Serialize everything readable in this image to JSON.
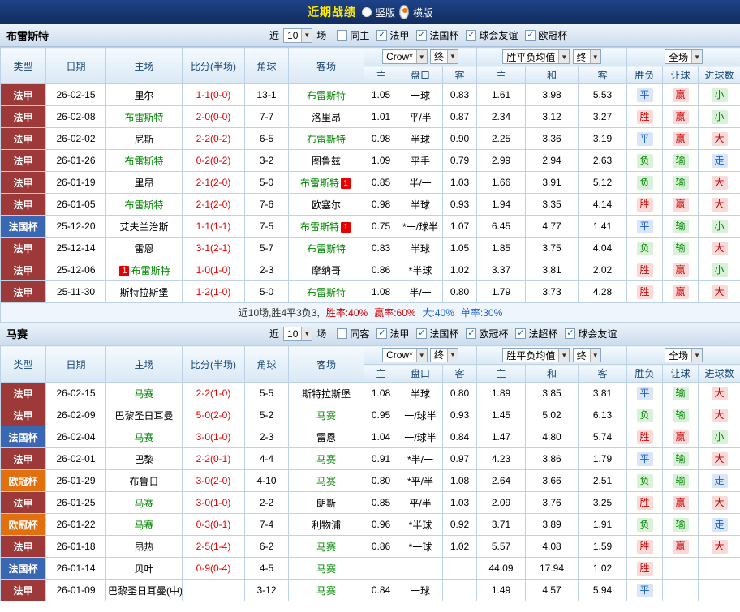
{
  "top_bar": {
    "title": "近期战绩",
    "vertical_label": "竖版",
    "horizontal_label": "横版",
    "selected_mode": "横版"
  },
  "labels": {
    "near": "近",
    "games": "场"
  },
  "table_header": {
    "fixed_cols": [
      "类型",
      "日期",
      "主场",
      "比分(半场)",
      "角球",
      "客场"
    ],
    "odds_source": "Crow*",
    "final": "终",
    "avg_source": "胜平负均值",
    "scope": "全场",
    "sub_cols": [
      "主",
      "盘口",
      "客",
      "主",
      "和",
      "客",
      "胜负",
      "让球",
      "进球数"
    ]
  },
  "colors": {
    "league": {
      "法甲": "#9e3939",
      "法国杯": "#3a67b1",
      "欧冠杯": "#e2700f"
    },
    "score": "#e60000",
    "focus_team": "#008800",
    "card_badge_bg": "#e60000",
    "badge": {
      "red": {
        "fg": "#cc0000",
        "bg": "#fad9d9"
      },
      "green": {
        "fg": "#008800",
        "bg": "#d9f0d9"
      },
      "blue": {
        "fg": "#1a5fd0",
        "bg": "#d9e6f8"
      }
    },
    "word_tone": {
      "胜": "red",
      "平": "blue",
      "负": "green",
      "赢": "red",
      "输": "green",
      "走": "blue",
      "大": "red",
      "小": "green"
    },
    "summary_plain": "#333333"
  },
  "sections": [
    {
      "team": "布雷斯特",
      "count": "10",
      "filters": [
        {
          "label": "同主",
          "checked": false
        },
        {
          "label": "法甲",
          "checked": true
        },
        {
          "label": "法国杯",
          "checked": true
        },
        {
          "label": "球会友谊",
          "checked": true
        },
        {
          "label": "欧冠杯",
          "checked": true
        }
      ],
      "rows": [
        {
          "type": "法甲",
          "date": "26-02-15",
          "home": "里尔",
          "home_focus": false,
          "home_card": "",
          "score": "1-1(0-0)",
          "corner": "13-1",
          "away": "布雷斯特",
          "away_focus": true,
          "away_card": "",
          "odds": [
            "1.05",
            "一球",
            "0.83"
          ],
          "avg": [
            "1.61",
            "3.98",
            "5.53"
          ],
          "results": [
            "平",
            "赢",
            "小"
          ]
        },
        {
          "type": "法甲",
          "date": "26-02-08",
          "home": "布雷斯特",
          "home_focus": true,
          "home_card": "",
          "score": "2-0(0-0)",
          "corner": "7-7",
          "away": "洛里昂",
          "away_focus": false,
          "away_card": "",
          "odds": [
            "1.01",
            "平/半",
            "0.87"
          ],
          "avg": [
            "2.34",
            "3.12",
            "3.27"
          ],
          "results": [
            "胜",
            "赢",
            "小"
          ]
        },
        {
          "type": "法甲",
          "date": "26-02-02",
          "home": "尼斯",
          "home_focus": false,
          "home_card": "",
          "score": "2-2(0-2)",
          "corner": "6-5",
          "away": "布雷斯特",
          "away_focus": true,
          "away_card": "",
          "odds": [
            "0.98",
            "半球",
            "0.90"
          ],
          "avg": [
            "2.25",
            "3.36",
            "3.19"
          ],
          "results": [
            "平",
            "赢",
            "大"
          ]
        },
        {
          "type": "法甲",
          "date": "26-01-26",
          "home": "布雷斯特",
          "home_focus": true,
          "home_card": "",
          "score": "0-2(0-2)",
          "corner": "3-2",
          "away": "图鲁兹",
          "away_focus": false,
          "away_card": "",
          "odds": [
            "1.09",
            "平手",
            "0.79"
          ],
          "avg": [
            "2.99",
            "2.94",
            "2.63"
          ],
          "results": [
            "负",
            "输",
            "走"
          ]
        },
        {
          "type": "法甲",
          "date": "26-01-19",
          "home": "里昂",
          "home_focus": false,
          "home_card": "",
          "score": "2-1(2-0)",
          "corner": "5-0",
          "away": "布雷斯特",
          "away_focus": true,
          "away_card": "1",
          "odds": [
            "0.85",
            "半/一",
            "1.03"
          ],
          "avg": [
            "1.66",
            "3.91",
            "5.12"
          ],
          "results": [
            "负",
            "输",
            "大"
          ]
        },
        {
          "type": "法甲",
          "date": "26-01-05",
          "home": "布雷斯特",
          "home_focus": true,
          "home_card": "",
          "score": "2-1(2-0)",
          "corner": "7-6",
          "away": "欧塞尔",
          "away_focus": false,
          "away_card": "",
          "odds": [
            "0.98",
            "半球",
            "0.93"
          ],
          "avg": [
            "1.94",
            "3.35",
            "4.14"
          ],
          "results": [
            "胜",
            "赢",
            "大"
          ]
        },
        {
          "type": "法国杯",
          "date": "25-12-20",
          "home": "艾夫兰治斯",
          "home_focus": false,
          "home_card": "",
          "score": "1-1(1-1)",
          "corner": "7-5",
          "away": "布雷斯特",
          "away_focus": true,
          "away_card": "1",
          "odds": [
            "0.75",
            "*一/球半",
            "1.07"
          ],
          "avg": [
            "6.45",
            "4.77",
            "1.41"
          ],
          "results": [
            "平",
            "输",
            "小"
          ]
        },
        {
          "type": "法甲",
          "date": "25-12-14",
          "home": "雷恩",
          "home_focus": false,
          "home_card": "",
          "score": "3-1(2-1)",
          "corner": "5-7",
          "away": "布雷斯特",
          "away_focus": true,
          "away_card": "",
          "odds": [
            "0.83",
            "半球",
            "1.05"
          ],
          "avg": [
            "1.85",
            "3.75",
            "4.04"
          ],
          "results": [
            "负",
            "输",
            "大"
          ]
        },
        {
          "type": "法甲",
          "date": "25-12-06",
          "home": "布雷斯特",
          "home_focus": true,
          "home_card": "1",
          "score": "1-0(1-0)",
          "corner": "2-3",
          "away": "摩纳哥",
          "away_focus": false,
          "away_card": "",
          "odds": [
            "0.86",
            "*半球",
            "1.02"
          ],
          "avg": [
            "3.37",
            "3.81",
            "2.02"
          ],
          "results": [
            "胜",
            "赢",
            "小"
          ]
        },
        {
          "type": "法甲",
          "date": "25-11-30",
          "home": "斯特拉斯堡",
          "home_focus": false,
          "home_card": "",
          "score": "1-2(1-0)",
          "corner": "5-0",
          "away": "布雷斯特",
          "away_focus": true,
          "away_card": "",
          "odds": [
            "1.08",
            "半/一",
            "0.80"
          ],
          "avg": [
            "1.79",
            "3.73",
            "4.28"
          ],
          "results": [
            "胜",
            "赢",
            "大"
          ]
        }
      ],
      "summary": [
        {
          "text": "近10场,胜4平3负3,",
          "tone": "plain"
        },
        {
          "text": "胜率:40%",
          "tone": "red"
        },
        {
          "text": "赢率:60%",
          "tone": "red"
        },
        {
          "text": "大:40%",
          "tone": "blue"
        },
        {
          "text": "单率:30%",
          "tone": "blue"
        }
      ]
    },
    {
      "team": "马赛",
      "count": "10",
      "filters": [
        {
          "label": "同客",
          "checked": false
        },
        {
          "label": "法甲",
          "checked": true
        },
        {
          "label": "法国杯",
          "checked": true
        },
        {
          "label": "欧冠杯",
          "checked": true
        },
        {
          "label": "法超杯",
          "checked": true
        },
        {
          "label": "球会友谊",
          "checked": true
        }
      ],
      "rows": [
        {
          "type": "法甲",
          "date": "26-02-15",
          "home": "马赛",
          "home_focus": true,
          "home_card": "",
          "score": "2-2(1-0)",
          "corner": "5-5",
          "away": "斯特拉斯堡",
          "away_focus": false,
          "away_card": "",
          "odds": [
            "1.08",
            "半球",
            "0.80"
          ],
          "avg": [
            "1.89",
            "3.85",
            "3.81"
          ],
          "results": [
            "平",
            "输",
            "大"
          ]
        },
        {
          "type": "法甲",
          "date": "26-02-09",
          "home": "巴黎圣日耳曼",
          "home_focus": false,
          "home_card": "",
          "score": "5-0(2-0)",
          "corner": "5-2",
          "away": "马赛",
          "away_focus": true,
          "away_card": "",
          "odds": [
            "0.95",
            "一/球半",
            "0.93"
          ],
          "avg": [
            "1.45",
            "5.02",
            "6.13"
          ],
          "results": [
            "负",
            "输",
            "大"
          ]
        },
        {
          "type": "法国杯",
          "date": "26-02-04",
          "home": "马赛",
          "home_focus": true,
          "home_card": "",
          "score": "3-0(1-0)",
          "corner": "2-3",
          "away": "雷恩",
          "away_focus": false,
          "away_card": "",
          "odds": [
            "1.04",
            "一/球半",
            "0.84"
          ],
          "avg": [
            "1.47",
            "4.80",
            "5.74"
          ],
          "results": [
            "胜",
            "赢",
            "小"
          ]
        },
        {
          "type": "法甲",
          "date": "26-02-01",
          "home": "巴黎",
          "home_focus": false,
          "home_card": "",
          "score": "2-2(0-1)",
          "corner": "4-4",
          "away": "马赛",
          "away_focus": true,
          "away_card": "",
          "odds": [
            "0.91",
            "*半/一",
            "0.97"
          ],
          "avg": [
            "4.23",
            "3.86",
            "1.79"
          ],
          "results": [
            "平",
            "输",
            "大"
          ]
        },
        {
          "type": "欧冠杯",
          "date": "26-01-29",
          "home": "布鲁日",
          "home_focus": false,
          "home_card": "",
          "score": "3-0(2-0)",
          "corner": "4-10",
          "away": "马赛",
          "away_focus": true,
          "away_card": "",
          "odds": [
            "0.80",
            "*平/半",
            "1.08"
          ],
          "avg": [
            "2.64",
            "3.66",
            "2.51"
          ],
          "results": [
            "负",
            "输",
            "走"
          ]
        },
        {
          "type": "法甲",
          "date": "26-01-25",
          "home": "马赛",
          "home_focus": true,
          "home_card": "",
          "score": "3-0(1-0)",
          "corner": "2-2",
          "away": "朗斯",
          "away_focus": false,
          "away_card": "",
          "odds": [
            "0.85",
            "平/半",
            "1.03"
          ],
          "avg": [
            "2.09",
            "3.76",
            "3.25"
          ],
          "results": [
            "胜",
            "赢",
            "大"
          ]
        },
        {
          "type": "欧冠杯",
          "date": "26-01-22",
          "home": "马赛",
          "home_focus": true,
          "home_card": "",
          "score": "0-3(0-1)",
          "corner": "7-4",
          "away": "利物浦",
          "away_focus": false,
          "away_card": "",
          "odds": [
            "0.96",
            "*半球",
            "0.92"
          ],
          "avg": [
            "3.71",
            "3.89",
            "1.91"
          ],
          "results": [
            "负",
            "输",
            "走"
          ]
        },
        {
          "type": "法甲",
          "date": "26-01-18",
          "home": "昂热",
          "home_focus": false,
          "home_card": "",
          "score": "2-5(1-4)",
          "corner": "6-2",
          "away": "马赛",
          "away_focus": true,
          "away_card": "",
          "odds": [
            "0.86",
            "*一球",
            "1.02"
          ],
          "avg": [
            "5.57",
            "4.08",
            "1.59"
          ],
          "results": [
            "胜",
            "赢",
            "大"
          ]
        },
        {
          "type": "法国杯",
          "date": "26-01-14",
          "home": "贝叶",
          "home_focus": false,
          "home_card": "",
          "score": "0-9(0-4)",
          "corner": "4-5",
          "away": "马赛",
          "away_focus": true,
          "away_card": "",
          "odds": [
            "",
            "",
            ""
          ],
          "avg": [
            "44.09",
            "17.94",
            "1.02"
          ],
          "results": [
            "胜",
            "",
            ""
          ]
        },
        {
          "type": "法甲",
          "date": "26-01-09",
          "home": "巴黎圣日耳曼(中)",
          "home_focus": false,
          "home_card": "",
          "score": "",
          "corner": "3-12",
          "away": "马赛",
          "away_focus": true,
          "away_card": "",
          "odds": [
            "0.84",
            "一球",
            ""
          ],
          "avg": [
            "1.49",
            "4.57",
            "5.94"
          ],
          "results": [
            "平",
            "",
            ""
          ]
        }
      ],
      "summary": null
    }
  ]
}
